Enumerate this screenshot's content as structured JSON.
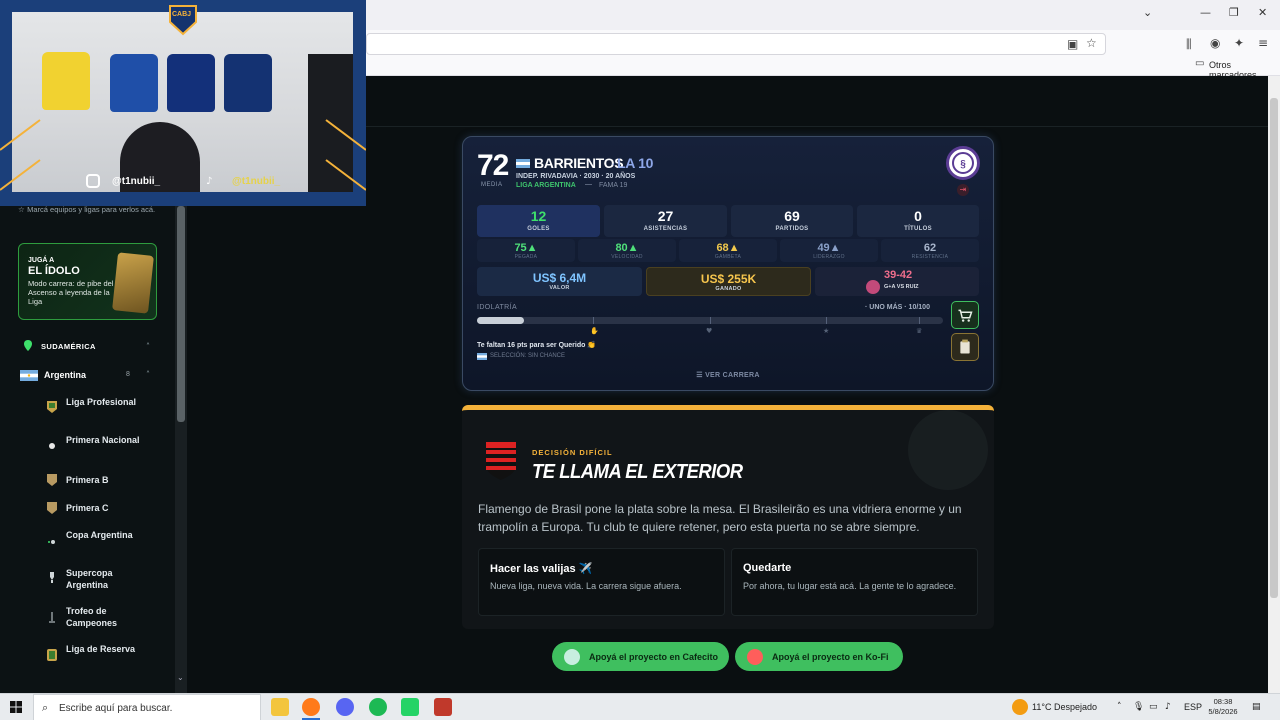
{
  "browser": {
    "other_bookmarks": "Otros marcadores"
  },
  "sidebar": {
    "hint": "Marcá equipos y ligas para verlos acá.",
    "promo": {
      "kicker": "JUGÁ A",
      "title": "EL ÍDOLO",
      "desc": "Modo carrera: de pibe del Ascenso a leyenda de la Liga"
    },
    "region": "SUDAMÉRICA",
    "country": "Argentina",
    "country_count": "8",
    "leagues": [
      {
        "label": "Liga Profesional"
      },
      {
        "label": "Primera Nacional"
      },
      {
        "label": "Primera B"
      },
      {
        "label": "Primera C"
      },
      {
        "label": "Copa Argentina"
      },
      {
        "label": "Supercopa Argentina"
      },
      {
        "label": "Trofeo de Campeones"
      },
      {
        "label": "Liga de Reserva"
      }
    ]
  },
  "webcam": {
    "instagram": "@t1nubii_",
    "tiktok": "@t1nubii_",
    "crest_text": "CABJ"
  },
  "player": {
    "rating": "72",
    "rating_label": "MEDIA",
    "name": "BARRIENTOS",
    "separator": "·",
    "alias": "LA 10",
    "club_line": "INDEP. RIVADAVIA · 2030 · 20 AÑOS",
    "league": "LIGA ARGENTINA",
    "dash": "—",
    "fame": "FAMA 19",
    "stats": [
      {
        "value": "12",
        "label": "GOLES",
        "color": "#3ee06b"
      },
      {
        "value": "27",
        "label": "ASISTENCIAS",
        "color": "#ffffff"
      },
      {
        "value": "69",
        "label": "PARTIDOS",
        "color": "#ffffff"
      },
      {
        "value": "0",
        "label": "TÍTULOS",
        "color": "#ffffff"
      }
    ],
    "attributes": [
      {
        "value": "75▲",
        "label": "PEGADA",
        "color": "#4fe07a"
      },
      {
        "value": "80▲",
        "label": "VELOCIDAD",
        "color": "#4fe07a"
      },
      {
        "value": "68▲",
        "label": "GAMBETA",
        "color": "#f2c94c"
      },
      {
        "value": "49▲",
        "label": "LIDERAZGO",
        "color": "#8aa0c8"
      },
      {
        "value": "62",
        "label": "RESISTENCIA",
        "color": "#a9b6cc"
      }
    ],
    "value": {
      "amount": "US$ 6,4M",
      "label": "VALOR"
    },
    "earned": {
      "amount": "US$ 255K",
      "label": "GANADO"
    },
    "derby": {
      "score": "39-42",
      "label": "G+A VS RUIZ"
    },
    "idolatry": {
      "label": "IDOLATRÍA",
      "status": "· UNO MÁS · 10/100",
      "progress": 0.1,
      "message": "Te faltan 16 pts para ser Querido 👏",
      "selection": "SELECCIÓN: SIN CHANCE"
    },
    "view_career": "☰  VER CARRERA"
  },
  "decision": {
    "kicker": "DECISIÓN DIFÍCIL",
    "title": "TE LLAMA EL EXTERIOR",
    "body": "Flamengo de Brasil pone la plata sobre la mesa. El Brasileirão es una vidriera enorme y un trampolín a Europa. Tu club te quiere retener, pero esta puerta no se abre siempre.",
    "options": [
      {
        "title": "Hacer las valijas ✈️",
        "desc": "Nueva liga, nueva vida. La carrera sigue afuera."
      },
      {
        "title": "Quedarte",
        "desc": "Por ahora, tu lugar está acá. La gente te lo agradece."
      }
    ]
  },
  "support": {
    "cafecito": "Apoyá el proyecto en Cafecito",
    "kofi": "Apoyá el proyecto en Ko-Fi"
  },
  "taskbar": {
    "search_placeholder": "Escribe aquí para buscar.",
    "weather": "11°C  Despejado",
    "lang": "ESP",
    "time": "08:38",
    "date": "5/8/2026"
  }
}
